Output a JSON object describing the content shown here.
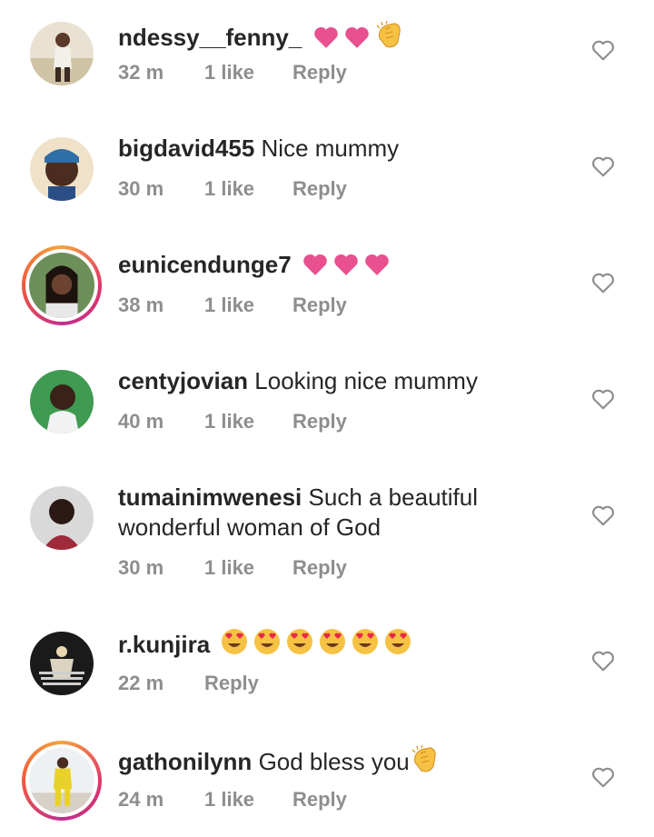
{
  "comments": [
    {
      "username": "ndessy__fenny_",
      "text": "",
      "emojis": [
        "pink-heart",
        "pink-heart",
        "clapping-hands"
      ],
      "time": "32 m",
      "likes": "1 like",
      "reply": "Reply",
      "ring": false
    },
    {
      "username": "bigdavid455",
      "text": "Nice mummy",
      "emojis": [],
      "time": "30 m",
      "likes": "1 like",
      "reply": "Reply",
      "ring": false
    },
    {
      "username": "eunicendunge7",
      "text": "",
      "emojis": [
        "pink-heart",
        "pink-heart",
        "pink-heart"
      ],
      "time": "38 m",
      "likes": "1 like",
      "reply": "Reply",
      "ring": true
    },
    {
      "username": "centyjovian",
      "text": "Looking nice mummy",
      "emojis": [],
      "time": "40 m",
      "likes": "1 like",
      "reply": "Reply",
      "ring": false
    },
    {
      "username": "tumainimwenesi",
      "text": "Such a beautiful wonderful woman of God",
      "emojis": [],
      "time": "30 m",
      "likes": "1 like",
      "reply": "Reply",
      "ring": false
    },
    {
      "username": "r.kunjira",
      "text": "",
      "emojis": [
        "heart-eyes",
        "heart-eyes",
        "heart-eyes",
        "heart-eyes",
        "heart-eyes",
        "heart-eyes"
      ],
      "time": "22 m",
      "likes": "",
      "reply": "Reply",
      "ring": false
    },
    {
      "username": "gathonilynn",
      "text": "God bless you",
      "emojis": [
        "clapping-hands"
      ],
      "time": "24 m",
      "likes": "1 like",
      "reply": "Reply",
      "ring": true
    }
  ],
  "colors": {
    "text": "#262626",
    "meta": "#8e8e8e",
    "pink_heart": "#e8508f",
    "ring_start": "#f4a33b",
    "ring_end": "#c02e8c"
  }
}
